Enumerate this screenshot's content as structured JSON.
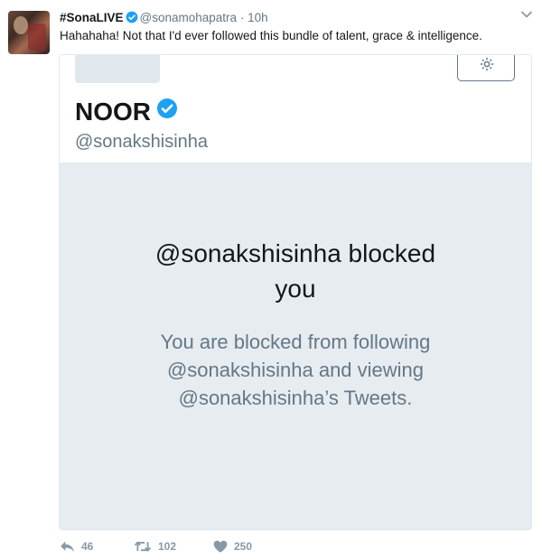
{
  "tweet": {
    "author_name": "#SonaLIVE",
    "author_handle": "@sonamohapatra",
    "separator": "·",
    "timestamp": "10h",
    "text": "Hahahaha! Not that I'd ever followed this bundle of talent, grace & intelligence."
  },
  "card": {
    "profile_name": "NOOR",
    "profile_handle": "@sonakshisinha",
    "blocked_title_line1": "@sonakshisinha blocked",
    "blocked_title_line2": "you",
    "blocked_desc_line1": "You are blocked from following",
    "blocked_desc_line2": "@sonakshisinha and viewing",
    "blocked_desc_line3": "@sonakshisinha’s Tweets."
  },
  "actions": {
    "reply_count": "46",
    "retweet_count": "102",
    "like_count": "250"
  },
  "colors": {
    "verified_blue": "#1da1f2",
    "muted_gray": "#657786",
    "blocked_bg": "#e6ecf0"
  },
  "icons": [
    "verified-icon",
    "chevron-down-icon",
    "gear-icon",
    "reply-icon",
    "retweet-icon",
    "heart-icon"
  ]
}
